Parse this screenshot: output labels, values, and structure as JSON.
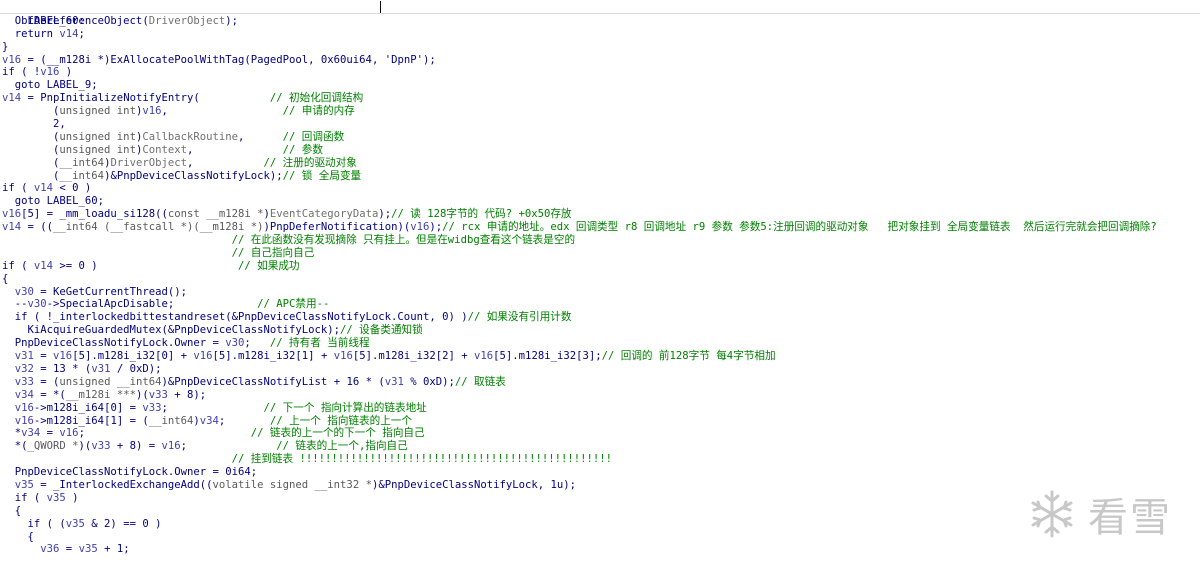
{
  "editor": {
    "title_label": "LABEL_60:",
    "lines": [
      [
        {
          "t": "  ObfDereferenceObject(",
          "c": "code"
        },
        {
          "t": "DriverObject",
          "c": "param"
        },
        {
          "t": ");",
          "c": "code"
        }
      ],
      [
        {
          "t": "  return ",
          "c": "code"
        },
        {
          "t": "v14",
          "c": "var"
        },
        {
          "t": ";",
          "c": "code"
        }
      ],
      [
        {
          "t": "}",
          "c": "code"
        }
      ],
      [
        {
          "t": "v16",
          "c": "var"
        },
        {
          "t": " = (__m128i *)ExAllocatePoolWithTag(PagedPool, ",
          "c": "code"
        },
        {
          "t": "0x60ui64",
          "c": "code"
        },
        {
          "t": ", ",
          "c": "code"
        },
        {
          "t": "'DpnP'",
          "c": "code"
        },
        {
          "t": ");",
          "c": "code"
        }
      ],
      [
        {
          "t": "if ( !",
          "c": "code"
        },
        {
          "t": "v16",
          "c": "var"
        },
        {
          "t": " )",
          "c": "code"
        }
      ],
      [
        {
          "t": "  goto LABEL_9;",
          "c": "code"
        }
      ],
      [
        {
          "t": "v14",
          "c": "var"
        },
        {
          "t": " = PnpInitializeNotifyEntry(           ",
          "c": "code"
        },
        {
          "t": "// 初始化回调结构",
          "c": "comment"
        }
      ],
      [
        {
          "t": "        (",
          "c": "code"
        },
        {
          "t": "unsigned int",
          "c": "gray"
        },
        {
          "t": ")",
          "c": "code"
        },
        {
          "t": "v16",
          "c": "var"
        },
        {
          "t": ",                  ",
          "c": "code"
        },
        {
          "t": "// 申请的内存",
          "c": "comment"
        }
      ],
      [
        {
          "t": "        2,",
          "c": "code"
        }
      ],
      [
        {
          "t": "        (",
          "c": "code"
        },
        {
          "t": "unsigned int",
          "c": "gray"
        },
        {
          "t": ")",
          "c": "code"
        },
        {
          "t": "CallbackRoutine",
          "c": "param"
        },
        {
          "t": ",      ",
          "c": "code"
        },
        {
          "t": "// 回调函数",
          "c": "comment"
        }
      ],
      [
        {
          "t": "        (",
          "c": "code"
        },
        {
          "t": "unsigned int",
          "c": "gray"
        },
        {
          "t": ")",
          "c": "code"
        },
        {
          "t": "Context",
          "c": "param"
        },
        {
          "t": ",              ",
          "c": "code"
        },
        {
          "t": "// 参数",
          "c": "comment"
        }
      ],
      [
        {
          "t": "        (",
          "c": "code"
        },
        {
          "t": "__int64",
          "c": "gray"
        },
        {
          "t": ")",
          "c": "code"
        },
        {
          "t": "DriverObject",
          "c": "param"
        },
        {
          "t": ",           ",
          "c": "code"
        },
        {
          "t": "// 注册的驱动对象",
          "c": "comment"
        }
      ],
      [
        {
          "t": "        (",
          "c": "code"
        },
        {
          "t": "__int64",
          "c": "gray"
        },
        {
          "t": ")&PnpDeviceClassNotifyLock);",
          "c": "code"
        },
        {
          "t": "// 锁 全局变量",
          "c": "comment"
        }
      ],
      [
        {
          "t": "if ( ",
          "c": "code"
        },
        {
          "t": "v14",
          "c": "var"
        },
        {
          "t": " < 0 )",
          "c": "code"
        }
      ],
      [
        {
          "t": "  goto LABEL_60;",
          "c": "code"
        }
      ],
      [
        {
          "t": "v16",
          "c": "var"
        },
        {
          "t": "[5] = _mm_loadu_si128((",
          "c": "code"
        },
        {
          "t": "const __m128i *",
          "c": "gray"
        },
        {
          "t": ")",
          "c": "code"
        },
        {
          "t": "EventCategoryData",
          "c": "param"
        },
        {
          "t": ");",
          "c": "code"
        },
        {
          "t": "// 读 128字节的 代码? +0x50存放",
          "c": "comment"
        }
      ],
      [
        {
          "t": "v14",
          "c": "var"
        },
        {
          "t": " = ((",
          "c": "code"
        },
        {
          "t": "__int64 (__fastcall *)(__m128i *)",
          "c": "gray"
        },
        {
          "t": ")PnpDeferNotification)(",
          "c": "code"
        },
        {
          "t": "v16",
          "c": "var"
        },
        {
          "t": ");",
          "c": "code"
        },
        {
          "t": "// rcx 申请的地址。edx 回调类型 r8 回调地址 r9 参数 参数5:注册回调的驱动对象   把对象挂到 全局变量链表  然后运行完就会把回调摘除?",
          "c": "comment"
        }
      ],
      [
        {
          "t": "                                    ",
          "c": "code"
        },
        {
          "t": "// 在此函数没有发现摘除 只有挂上。但是在widbg查看这个链表是空的",
          "c": "comment"
        }
      ],
      [
        {
          "t": "                                    ",
          "c": "code"
        },
        {
          "t": "// 自己指向自己",
          "c": "comment"
        }
      ],
      [
        {
          "t": "if ( ",
          "c": "code"
        },
        {
          "t": "v14",
          "c": "var"
        },
        {
          "t": " >= 0 )                      ",
          "c": "code"
        },
        {
          "t": "// 如果成功",
          "c": "comment"
        }
      ],
      [
        {
          "t": "{",
          "c": "code"
        }
      ],
      [
        {
          "t": "  ",
          "c": "code"
        },
        {
          "t": "v30",
          "c": "var"
        },
        {
          "t": " = KeGetCurrentThread();",
          "c": "code"
        }
      ],
      [
        {
          "t": "  --",
          "c": "code"
        },
        {
          "t": "v30",
          "c": "var"
        },
        {
          "t": "->SpecialApcDisable;             ",
          "c": "code"
        },
        {
          "t": "// APC禁用--",
          "c": "comment"
        }
      ],
      [
        {
          "t": "  if ( !_interlockedbittestandreset(&PnpDeviceClassNotifyLock.Count, 0) )",
          "c": "code"
        },
        {
          "t": "// 如果没有引用计数",
          "c": "comment"
        }
      ],
      [
        {
          "t": "    KiAcquireGuardedMutex(&PnpDeviceClassNotifyLock);",
          "c": "code"
        },
        {
          "t": "// 设备类通知锁",
          "c": "comment"
        }
      ],
      [
        {
          "t": "  PnpDeviceClassNotifyLock.Owner = ",
          "c": "code"
        },
        {
          "t": "v30",
          "c": "var"
        },
        {
          "t": ";   ",
          "c": "code"
        },
        {
          "t": "// 持有者 当前线程",
          "c": "comment"
        }
      ],
      [
        {
          "t": "  ",
          "c": "code"
        },
        {
          "t": "v31",
          "c": "var"
        },
        {
          "t": " = ",
          "c": "code"
        },
        {
          "t": "v16",
          "c": "var"
        },
        {
          "t": "[5].m128i_i32[0] + ",
          "c": "code"
        },
        {
          "t": "v16",
          "c": "var"
        },
        {
          "t": "[5].m128i_i32[1] + ",
          "c": "code"
        },
        {
          "t": "v16",
          "c": "var"
        },
        {
          "t": "[5].m128i_i32[2] + ",
          "c": "code"
        },
        {
          "t": "v16",
          "c": "var"
        },
        {
          "t": "[5].m128i_i32[3];",
          "c": "code"
        },
        {
          "t": "// 回调的 前128字节 每4字节相加",
          "c": "comment"
        }
      ],
      [
        {
          "t": "  ",
          "c": "code"
        },
        {
          "t": "v32",
          "c": "var"
        },
        {
          "t": " = 13 * (",
          "c": "code"
        },
        {
          "t": "v31",
          "c": "var"
        },
        {
          "t": " / 0xD);",
          "c": "code"
        }
      ],
      [
        {
          "t": "  ",
          "c": "code"
        },
        {
          "t": "v33",
          "c": "var"
        },
        {
          "t": " = (",
          "c": "code"
        },
        {
          "t": "unsigned __int64",
          "c": "gray"
        },
        {
          "t": ")&PnpDeviceClassNotifyList + 16 * (",
          "c": "code"
        },
        {
          "t": "v31",
          "c": "var"
        },
        {
          "t": " % 0xD);",
          "c": "code"
        },
        {
          "t": "// 取链表",
          "c": "comment"
        }
      ],
      [
        {
          "t": "  ",
          "c": "code"
        },
        {
          "t": "v34",
          "c": "var"
        },
        {
          "t": " = *(",
          "c": "code"
        },
        {
          "t": "__m128i ***",
          "c": "gray"
        },
        {
          "t": ")(",
          "c": "code"
        },
        {
          "t": "v33",
          "c": "var"
        },
        {
          "t": " + 8);",
          "c": "code"
        }
      ],
      [
        {
          "t": "  ",
          "c": "code"
        },
        {
          "t": "v16",
          "c": "var"
        },
        {
          "t": "->m128i_i64[0] = ",
          "c": "code"
        },
        {
          "t": "v33",
          "c": "var"
        },
        {
          "t": ";               ",
          "c": "code"
        },
        {
          "t": "// 下一个 指向计算出的链表地址",
          "c": "comment"
        }
      ],
      [
        {
          "t": "  ",
          "c": "code"
        },
        {
          "t": "v16",
          "c": "var"
        },
        {
          "t": "->m128i_i64[1] = (",
          "c": "code"
        },
        {
          "t": "__int64",
          "c": "gray"
        },
        {
          "t": ")",
          "c": "code"
        },
        {
          "t": "v34",
          "c": "var"
        },
        {
          "t": ";       ",
          "c": "code"
        },
        {
          "t": "// 上一个 指向链表的上一个",
          "c": "comment"
        }
      ],
      [
        {
          "t": "  *",
          "c": "code"
        },
        {
          "t": "v34",
          "c": "var"
        },
        {
          "t": " = ",
          "c": "code"
        },
        {
          "t": "v16",
          "c": "var"
        },
        {
          "t": ";                          ",
          "c": "code"
        },
        {
          "t": "// 链表的上一个的下一个 指向自己",
          "c": "comment"
        }
      ],
      [
        {
          "t": "  *(",
          "c": "code"
        },
        {
          "t": "_QWORD *",
          "c": "gray"
        },
        {
          "t": ")(",
          "c": "code"
        },
        {
          "t": "v33",
          "c": "var"
        },
        {
          "t": " + 8) = ",
          "c": "code"
        },
        {
          "t": "v16",
          "c": "var"
        },
        {
          "t": ";              ",
          "c": "code"
        },
        {
          "t": "// 链表的上一个,指向自己",
          "c": "comment"
        }
      ],
      [
        {
          "t": "                                    ",
          "c": "code"
        },
        {
          "t": "// 挂到链表 !!!!!!!!!!!!!!!!!!!!!!!!!!!!!!!!!!!!!!!!!!!!!!!!!",
          "c": "comment"
        }
      ],
      [
        {
          "t": "  PnpDeviceClassNotifyLock.Owner = 0i64;",
          "c": "code"
        }
      ],
      [
        {
          "t": "  ",
          "c": "code"
        },
        {
          "t": "v35",
          "c": "var"
        },
        {
          "t": " = _InterlockedExchangeAdd((",
          "c": "code"
        },
        {
          "t": "volatile signed __int32 *",
          "c": "gray"
        },
        {
          "t": ")&PnpDeviceClassNotifyLock, 1u);",
          "c": "code"
        }
      ],
      [
        {
          "t": "  if ( ",
          "c": "code"
        },
        {
          "t": "v35",
          "c": "var"
        },
        {
          "t": " )",
          "c": "code"
        }
      ],
      [
        {
          "t": "  {",
          "c": "code"
        }
      ],
      [
        {
          "t": "    if ( (",
          "c": "code"
        },
        {
          "t": "v35",
          "c": "var"
        },
        {
          "t": " & 2) == 0 )",
          "c": "code"
        }
      ],
      [
        {
          "t": "    {",
          "c": "code"
        }
      ],
      [
        {
          "t": "      ",
          "c": "code"
        },
        {
          "t": "v36",
          "c": "var"
        },
        {
          "t": " = ",
          "c": "code"
        },
        {
          "t": "v35",
          "c": "var"
        },
        {
          "t": " + 1;",
          "c": "code"
        }
      ]
    ]
  },
  "watermark": {
    "text": "看雪",
    "icon": "snowflake-icon",
    "color": "#c8c8c8"
  }
}
